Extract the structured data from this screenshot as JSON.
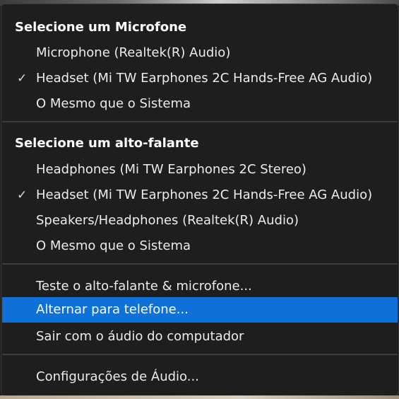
{
  "microphone_section": {
    "title": "Selecione um Microfone",
    "items": [
      {
        "label": "Microphone (Realtek(R) Audio)",
        "checked": false
      },
      {
        "label": "Headset (Mi TW Earphones 2C Hands-Free AG Audio)",
        "checked": true,
        "check_glyph": "✓"
      },
      {
        "label": "O Mesmo que o Sistema",
        "checked": false
      }
    ]
  },
  "speaker_section": {
    "title": "Selecione um alto-falante",
    "items": [
      {
        "label": "Headphones (Mi TW Earphones 2C Stereo)",
        "checked": false
      },
      {
        "label": "Headset (Mi TW Earphones 2C Hands-Free AG Audio)",
        "checked": true,
        "check_glyph": "✓"
      },
      {
        "label": "Speakers/Headphones (Realtek(R) Audio)",
        "checked": false
      },
      {
        "label": "O Mesmo que o Sistema",
        "checked": false
      }
    ]
  },
  "actions": {
    "test": "Teste o alto-falante & microfone...",
    "switch_phone": "Alternar para telefone...",
    "leave_audio": "Sair com o áudio do computador"
  },
  "settings": {
    "audio_settings": "Configurações de Áudio..."
  },
  "colors": {
    "menu_background": "#1e1e1e",
    "highlight": "#0e70d9",
    "text": "#ececec",
    "divider": "#3b3b3b"
  }
}
